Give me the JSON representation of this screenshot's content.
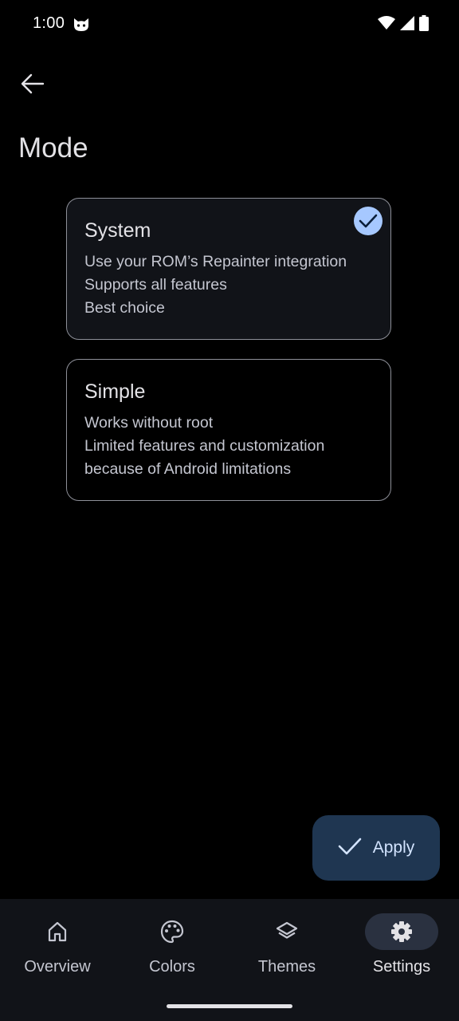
{
  "status_bar": {
    "time": "1:00",
    "icons": [
      "cat-icon",
      "wifi-icon",
      "signal-icon",
      "battery-icon"
    ]
  },
  "header": {
    "back_icon": "arrow-back-icon",
    "title": "Mode"
  },
  "modes": [
    {
      "title": "System",
      "lines": [
        "Use your ROM’s Repainter integration",
        "Supports all features",
        "Best choice"
      ],
      "selected": true
    },
    {
      "title": "Simple",
      "lines": [
        "Works without root",
        "Limited features and customization",
        "because of Android limitations"
      ],
      "selected": false
    }
  ],
  "fab": {
    "icon": "check-icon",
    "label": "Apply"
  },
  "nav": {
    "items": [
      {
        "label": "Overview",
        "icon": "home-icon",
        "active": false
      },
      {
        "label": "Colors",
        "icon": "palette-icon",
        "active": false
      },
      {
        "label": "Themes",
        "icon": "layers-icon",
        "active": false
      },
      {
        "label": "Settings",
        "icon": "gear-icon",
        "active": true
      }
    ]
  },
  "colors": {
    "background": "#000000",
    "card_selected": "#111318",
    "card_border": "#8e9099",
    "accent": "#a6c8ff",
    "fab_background": "#1f3651",
    "nav_background": "#111318",
    "nav_active_pill": "#2a3140"
  }
}
